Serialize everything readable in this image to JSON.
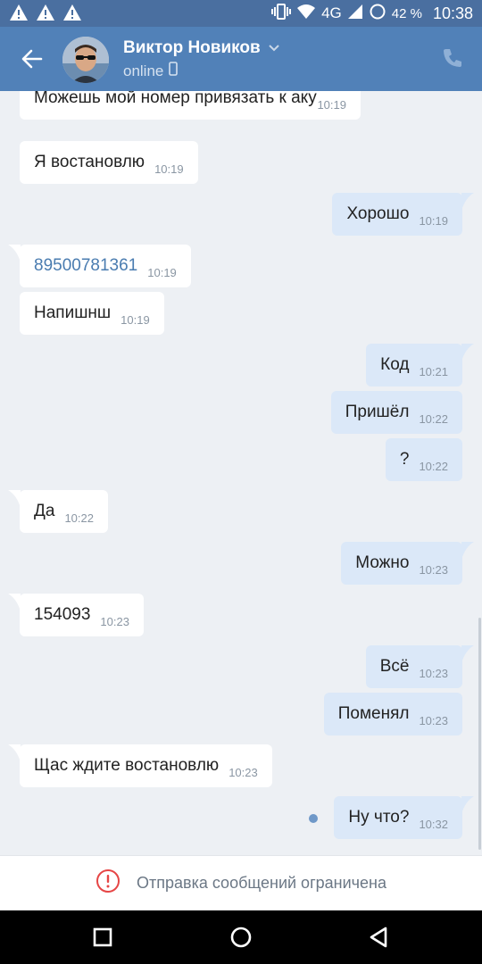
{
  "status_bar": {
    "network": "4G",
    "battery": "42 %",
    "time": "10:38",
    "icons": [
      "warning-icon",
      "warning-icon",
      "warning-icon",
      "vibrate-icon",
      "wifi-icon",
      "signal-icon",
      "data-saver-icon"
    ]
  },
  "header": {
    "name": "Виктор Новиков",
    "status": "online",
    "icons": [
      "back-arrow-icon",
      "chevron-down-icon",
      "mobile-icon",
      "phone-icon"
    ]
  },
  "messages": [
    {
      "dir": "in",
      "text": "Можешь мой номер привязать к аку",
      "time": "10:19"
    },
    {
      "dir": "in",
      "text": "Я востановлю",
      "time": "10:19"
    },
    {
      "dir": "out",
      "text": "Хорошо",
      "time": "10:19"
    },
    {
      "dir": "in",
      "text": "89500781361",
      "time": "10:19",
      "link": true
    },
    {
      "dir": "in",
      "text": "Напишнш",
      "time": "10:19"
    },
    {
      "dir": "out",
      "text": "Код",
      "time": "10:21"
    },
    {
      "dir": "out",
      "text": "Пришёл",
      "time": "10:22"
    },
    {
      "dir": "out",
      "text": "?",
      "time": "10:22"
    },
    {
      "dir": "in",
      "text": "Да",
      "time": "10:22"
    },
    {
      "dir": "out",
      "text": "Можно",
      "time": "10:23"
    },
    {
      "dir": "in",
      "text": "154093",
      "time": "10:23"
    },
    {
      "dir": "out",
      "text": "Всё",
      "time": "10:23"
    },
    {
      "dir": "out",
      "text": "Поменял",
      "time": "10:23"
    },
    {
      "dir": "in",
      "text": "Щас ждите востановлю",
      "time": "10:23"
    },
    {
      "dir": "out",
      "text": "Ну что?",
      "time": "10:32",
      "unread": true
    }
  ],
  "footer": {
    "restriction_text": "Отправка сообщений ограничена",
    "icon": "alert-circle-icon"
  },
  "nav_bar": {
    "icons": [
      "recents-square-icon",
      "home-circle-icon",
      "back-triangle-icon"
    ]
  },
  "colors": {
    "header": "#5181b8",
    "status_bar": "#4a6fa0",
    "chat_bg": "#edf0f4",
    "bubble_in": "#ffffff",
    "bubble_out": "#dbe8f8",
    "alert": "#e64646"
  }
}
